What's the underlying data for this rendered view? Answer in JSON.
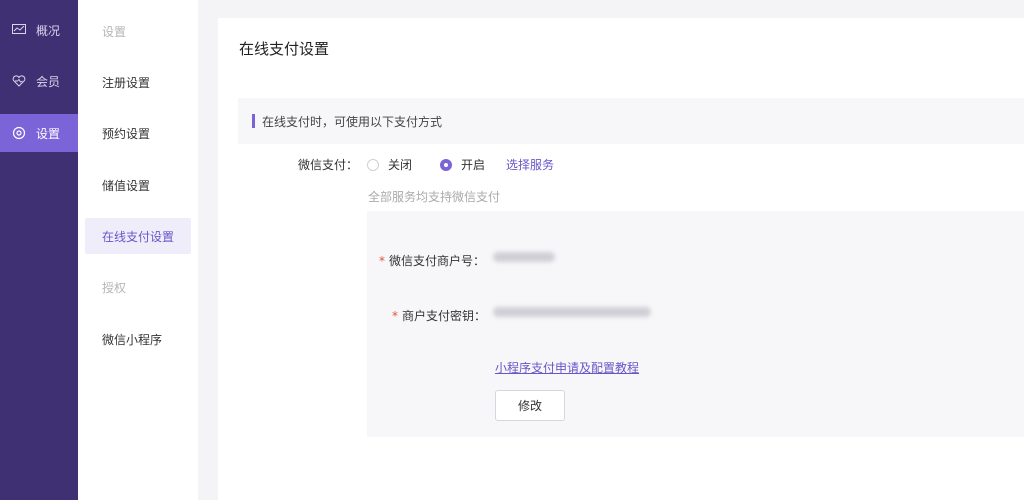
{
  "nav": {
    "items": [
      {
        "label": "概况",
        "icon": "chart-icon",
        "active": false
      },
      {
        "label": "会员",
        "icon": "heart-icon",
        "active": false
      },
      {
        "label": "设置",
        "icon": "settings-circle-icon",
        "active": true
      }
    ]
  },
  "submenu": {
    "items": [
      {
        "label": "设置",
        "muted": true
      },
      {
        "label": "注册设置"
      },
      {
        "label": "预约设置"
      },
      {
        "label": "储值设置"
      },
      {
        "label": "在线支付设置",
        "active": true
      },
      {
        "label": "授权",
        "muted": true
      },
      {
        "label": "微信小程序"
      }
    ]
  },
  "main": {
    "title": "在线支付设置",
    "notice": "在线支付时，可使用以下支付方式",
    "wechat_pay": {
      "label": "微信支付：",
      "option_off": "关闭",
      "option_on": "开启",
      "selected": "开启",
      "select_service": "选择服务",
      "hint": "全部服务均支持微信支付"
    },
    "fields": {
      "merchant_id_label": "微信支付商户号：",
      "merchant_key_label": "商户支付密钥："
    },
    "tutorial_link": "小程序支付申请及配置教程",
    "edit_button": "修改"
  },
  "colors": {
    "nav_bg": "#3f2f73",
    "accent": "#7b63d8",
    "link": "#6a55c8",
    "required": "#e0533c"
  }
}
